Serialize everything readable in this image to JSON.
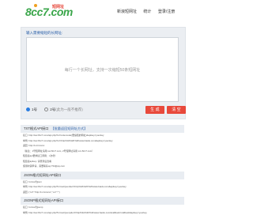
{
  "header": {
    "logo_text": "8cc7.com",
    "logo_sub": "短网址",
    "nav": [
      "新浪短网址",
      "统计",
      "登录/注册"
    ]
  },
  "form": {
    "prompt": "输入需要缩短的长网址:",
    "placeholder": "每行一个长网址，支持一次缩短50条短网址",
    "radio1": "1号",
    "radio2": "2号",
    "radio2_note": "(此为一般不推荐)",
    "generate_label": "生 成",
    "clear_label": "清 空"
  },
  "sections": [
    {
      "title": "TXT格式API接口",
      "link": "【批量返回短网址方式】",
      "lines": [
        "接口: http://sur.8cc7.com/api.php?url=urlencode(要缩短的网址)&apikey=yourkey",
        "举例: http://sur.8cc7.com/api.php?url=http%3A%2F%2Fwww.baidu.com&apikey=yourkey",
        "返回: http://t.cn/xxxxx",
        "（备注：1号短网址请用 sur.8cc7.com, 2号短网址请用 xxx.8cc7.com）",
        "短链接api要求接口调用：n次/秒",
        "短链接apikey: 请登录后查看",
        "使用时需申请，需要联系qq:734@qq.com"
      ]
    },
    {
      "title": "JSON格式短网址API接口",
      "link": "",
      "lines": [
        "接口: format为json",
        "举例: http://sur.8cc7.com/api.php?format=json&url=http%3A%2F%2Fwww.baidu.com&apikey=yourkey",
        "返回: {\"url\":\"http://t.cn/xxxxx\",\"err\":\"\"}"
      ]
    },
    {
      "title": "JSONP格式短网址API接口",
      "link": "",
      "lines": [
        "接口: format为jsonp",
        "举例: http://sur.8cc7.com/api.php?format=jsonp&url=http%3A%2F%2Fwww.baidu.com&callback=callback&apikey=yourkey"
      ]
    }
  ]
}
